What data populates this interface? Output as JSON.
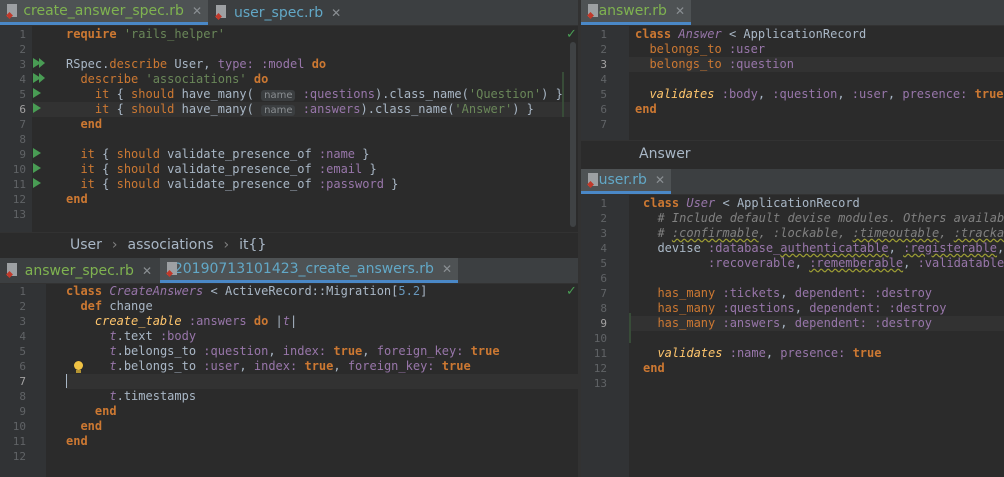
{
  "left_top": {
    "tabs": [
      {
        "label": "create_answer_spec.rb",
        "active": true
      },
      {
        "label": "user_spec.rb",
        "active": false
      }
    ],
    "line_numbers": [
      "1",
      "2",
      "3",
      "4",
      "5",
      "6",
      "7",
      "8",
      "9",
      "10",
      "11",
      "12",
      "13"
    ],
    "lines": [
      "require 'rails_helper'",
      "",
      "RSpec.describe User, type: :model do",
      "  describe 'associations' do",
      "    it { should have_many( name :questions).class_name('Question') }",
      "    it { should have_many( name :answers).class_name('Answer') }",
      "  end",
      "",
      "  it { should validate_presence_of :name }",
      "  it { should validate_presence_of :email }",
      "  it { should validate_presence_of :password }",
      "end",
      ""
    ],
    "hint_label": "name",
    "breadcrumb": [
      "User",
      "associations",
      "it{}"
    ]
  },
  "left_bottom": {
    "tabs": [
      {
        "label": "answer_spec.rb",
        "active": false
      },
      {
        "label": "20190713101423_create_answers.rb",
        "active": true
      }
    ],
    "line_numbers": [
      "1",
      "2",
      "3",
      "4",
      "5",
      "6",
      "7",
      "8",
      "9",
      "10",
      "11",
      "12"
    ],
    "lines": [
      "class CreateAnswers < ActiveRecord::Migration[5.2]",
      "  def change",
      "    create_table :answers do |t|",
      "      t.text :body",
      "      t.belongs_to :question, index: true, foreign_key: true",
      "      t.belongs_to :user, index: true, foreign_key: true",
      "",
      "      t.timestamps",
      "    end",
      "  end",
      "end",
      ""
    ]
  },
  "right_top": {
    "tabs": [
      {
        "label": "answer.rb",
        "active": true
      }
    ],
    "line_numbers": [
      "1",
      "2",
      "3",
      "4",
      "5",
      "6",
      "7"
    ],
    "lines": [
      "class Answer < ApplicationRecord",
      "  belongs_to :user",
      "  belongs_to :question",
      "",
      "  validates :body, :question, :user, presence: true",
      "end",
      ""
    ],
    "breadcrumb": "Answer"
  },
  "right_bottom": {
    "tabs": [
      {
        "label": "user.rb",
        "active": true
      }
    ],
    "line_numbers": [
      "1",
      "2",
      "3",
      "4",
      "5",
      "6",
      "7",
      "8",
      "9",
      "10",
      "11",
      "12",
      "13"
    ],
    "lines": [
      "class User < ApplicationRecord",
      "  # Include default devise modules. Others available",
      "  # :confirmable, :lockable, :timeoutable, :trackabl",
      "  devise :database_authenticatable, :registerable,",
      "         :recoverable, :rememberable, :validatable,",
      "",
      "  has_many :tickets, dependent: :destroy",
      "  has_many :questions, dependent: :destroy",
      "  has_many :answers, dependent: :destroy",
      "",
      "  validates :name, presence: true",
      "end",
      ""
    ]
  },
  "colors": {
    "background": "#2b2b2b",
    "gutter": "#313335",
    "keyword": "#cc7832",
    "string": "#6a8759",
    "symbol": "#9876aa",
    "tab_active_underline": "#4a88c7",
    "run_icon": "#499c54"
  }
}
